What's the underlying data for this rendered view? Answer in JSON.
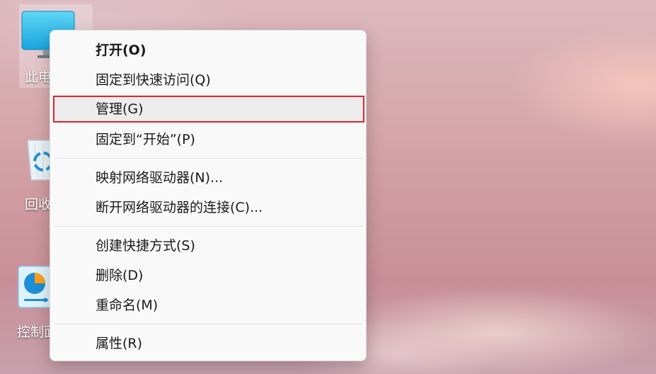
{
  "desktop": {
    "icons": [
      {
        "label": "此电",
        "icon": "computer-icon"
      },
      {
        "label": "回收",
        "icon": "recycle-bin-icon"
      },
      {
        "label": "控制面",
        "icon": "control-panel-icon"
      }
    ]
  },
  "context_menu": {
    "items": [
      {
        "label": "打开(O)",
        "bold": true
      },
      {
        "label": "固定到快速访问(Q)"
      },
      {
        "label": "管理(G)",
        "highlighted": true
      },
      {
        "label": "固定到“开始”(P)"
      },
      {
        "label": "映射网络驱动器(N)..."
      },
      {
        "label": "断开网络驱动器的连接(C)..."
      },
      {
        "label": "创建快捷方式(S)"
      },
      {
        "label": "删除(D)"
      },
      {
        "label": "重命名(M)"
      },
      {
        "label": "属性(R)"
      }
    ]
  },
  "colors": {
    "highlight_border": "#e0232f",
    "menu_background": "#f9f9f9"
  }
}
